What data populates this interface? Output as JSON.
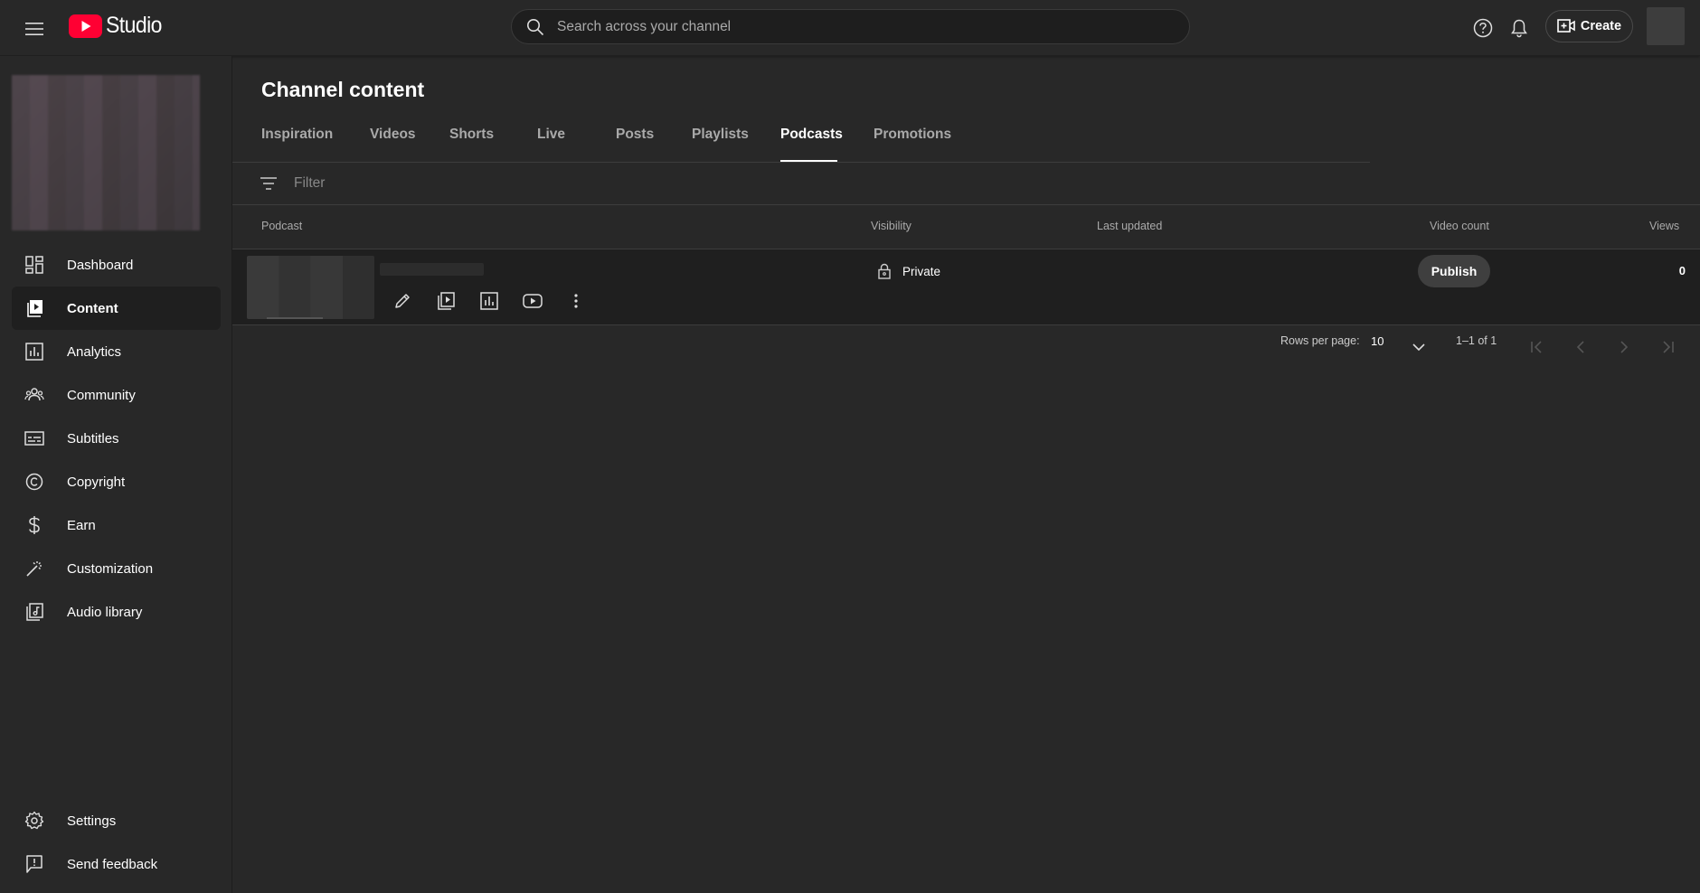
{
  "header": {
    "app_name": "Studio",
    "search_placeholder": "Search across your channel",
    "create_label": "Create"
  },
  "sidebar": {
    "items": [
      {
        "label": "Dashboard",
        "icon": "dashboard-icon"
      },
      {
        "label": "Content",
        "icon": "content-icon",
        "active": true
      },
      {
        "label": "Analytics",
        "icon": "analytics-icon"
      },
      {
        "label": "Community",
        "icon": "community-icon"
      },
      {
        "label": "Subtitles",
        "icon": "subtitles-icon"
      },
      {
        "label": "Copyright",
        "icon": "copyright-icon"
      },
      {
        "label": "Earn",
        "icon": "earn-icon"
      },
      {
        "label": "Customization",
        "icon": "customization-icon"
      },
      {
        "label": "Audio library",
        "icon": "audio-library-icon"
      }
    ],
    "bottom": [
      {
        "label": "Settings",
        "icon": "settings-icon"
      },
      {
        "label": "Send feedback",
        "icon": "feedback-icon"
      }
    ]
  },
  "main": {
    "title": "Channel content",
    "tabs": [
      {
        "label": "Inspiration"
      },
      {
        "label": "Videos"
      },
      {
        "label": "Shorts"
      },
      {
        "label": "Live"
      },
      {
        "label": "Posts"
      },
      {
        "label": "Playlists"
      },
      {
        "label": "Podcasts",
        "active": true
      },
      {
        "label": "Promotions"
      }
    ],
    "filter_placeholder": "Filter",
    "table": {
      "columns": {
        "podcast": "Podcast",
        "visibility": "Visibility",
        "last_updated": "Last updated",
        "video_count": "Video count",
        "views": "Views"
      },
      "rows": [
        {
          "visibility": "Private",
          "publish_label": "Publish",
          "views": "0"
        }
      ]
    },
    "pagination": {
      "rows_per_page_label": "Rows per page:",
      "rows_per_page": "10",
      "range": "1–1 of 1"
    }
  },
  "colors": {
    "background": "#282828",
    "row_background": "#1f1f1f",
    "brand_red": "#ff0033",
    "secondary_text": "#aaaaaa"
  }
}
